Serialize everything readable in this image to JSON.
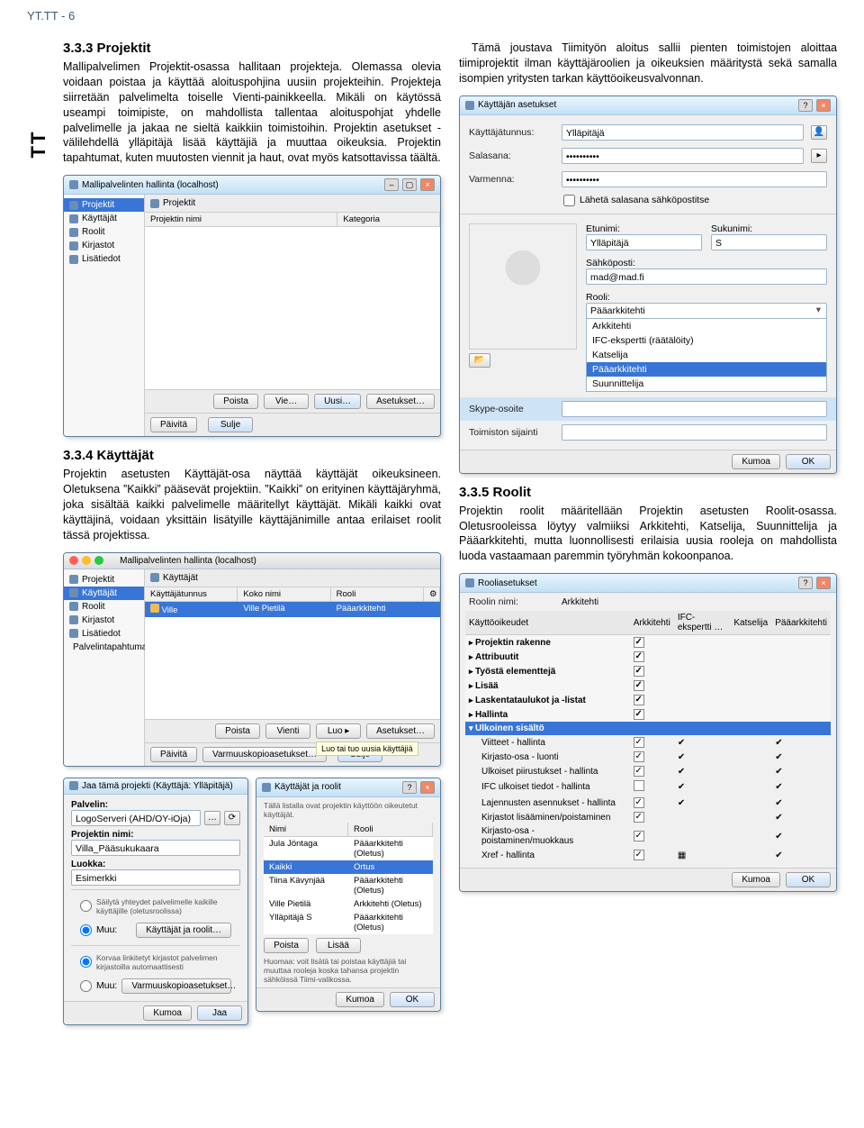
{
  "page": {
    "header": "YT.TT - 6",
    "side_label": "TT"
  },
  "col1": {
    "h1": "3.3.3   Projektit",
    "p1": "Mallipalvelimen Projektit-osassa hallitaan projekteja. Olemassa olevia voidaan poistaa ja käyttää aloituspohjina uusiin projekteihin. Projekteja siirretään palvelimelta toiselle Vienti-painikkeella. Mikäli on käytössä useampi toimipiste, on mahdollista tallentaa aloituspohjat yhdelle palvelimelle ja jakaa ne sieltä kaikkiin toimistoihin. Projektin asetukset -välilehdellä ylläpitäjä lisää käyttäjiä ja muuttaa oikeuksia. Projektin tapahtumat, kuten muutosten viennit ja haut, ovat myös katsottavissa täältä.",
    "win1": {
      "title": "Mallipalvelinten hallinta (localhost)",
      "crumb": "Projektit",
      "sidebar": [
        "Projektit",
        "Käyttäjät",
        "Roolit",
        "Kirjastot",
        "Lisätiedot"
      ],
      "cols": [
        "Projektin nimi",
        "Kategoria"
      ],
      "btn_del": "Poista",
      "btn_export": "Vie…",
      "btn_new": "Uusi…",
      "btn_settings": "Asetukset…",
      "btn_refresh": "Päivitä",
      "btn_close": "Sulje"
    },
    "h2": "3.3.4   Käyttäjät",
    "p2": "Projektin asetusten Käyttäjät-osa näyttää käyttäjät oikeuksineen. Oletuksena ”Kaikki” pääsevät projektiin. ”Kaikki” on erityinen käyttäjäryhmä, joka sisältää kaikki palvelimelle määritellyt käyttäjät. Mikäli kaikki ovat käyttäjinä, voidaan yksittäin lisätyille käyttäjänimille antaa erilaiset roolit tässä projektissa.",
    "win2": {
      "title": "Mallipalvelinten hallinta (localhost)",
      "crumb": "Käyttäjät",
      "sidebar": [
        "Projektit",
        "Käyttäjät",
        "Roolit",
        "Kirjastot",
        "Lisätiedot",
        "Palvelintapahtumat"
      ],
      "cols": [
        "Käyttäjätunnus",
        "Koko nimi",
        "Rooli"
      ],
      "row_user": "Ville",
      "row_name": "Ville Pietilä",
      "row_role": "Pääarkkitehti",
      "btn_del": "Poista",
      "btn_export": "Vienti",
      "btn_new": "Luo",
      "btn_settings": "Asetukset…",
      "hint": "Luo tai tuo uusia käyttäjiä",
      "btn_refresh": "Päivitä",
      "btn_backup": "Varmuuskopioasetukset…",
      "btn_close": "Sulje"
    },
    "win3a": {
      "title": "Jaa tämä projekti (Käyttäjä: Ylläpitäjä)",
      "server_lbl": "Palvelin:",
      "server_val": "LogoServeri (AHD/OY-iOja)",
      "proj_lbl": "Projektin nimi:",
      "proj_val": "Villa_Pääsukukaara",
      "class_lbl": "Luokka:",
      "class_val": "Esimerkki",
      "opt1": "Säilytä yhteydet palvelimelle kaikille käyttäjille (oletusroolissa)",
      "opt2": "Muu:",
      "btn_users": "Käyttäjät ja roolit…",
      "opt3_pre": "Korvaa linkitetyt kirjastot palvelimen kirjastoilla automaattisesti",
      "opt4": "Muu:",
      "btn_lib": "Varmuuskopioasetukset…",
      "btn_cancel": "Kumoa",
      "btn_ok": "Jaa"
    },
    "win3b": {
      "title": "Käyttäjät ja roolit",
      "desc": "Tällä listalla ovat projektin käyttöön oikeutetut käyttäjät.",
      "cols": [
        "Nimi",
        "Rooli"
      ],
      "rows": [
        {
          "n": "Jula Jöntaga",
          "r": "Pääarkkitehti (Oletus)"
        },
        {
          "n": "Kaikki",
          "r": "Ortus"
        },
        {
          "n": "Tiina Kävynjää",
          "r": "Pääarkkitehti (Oletus)"
        },
        {
          "n": "Ville Pietilä",
          "r": "Arkkitehti (Oletus)"
        },
        {
          "n": "Ylläpitäjä S",
          "r": "Pääarkkitehti (Oletus)"
        }
      ],
      "hint": "Huomaa: voit lisätä tai poistaa käyttäjiä tai muuttaa rooleja koska tahansa projektin sähköissä Tiimi-valikossa.",
      "btn_cancel": "Kumoa",
      "btn_ok": "Lisää",
      "btn_del": "Poista"
    }
  },
  "col2": {
    "p1": "Tämä joustava Tiimityön aloitus sallii pienten toimistojen aloittaa tiimiprojektit ilman käyttäjäroolien ja oikeuksien määritystä sekä samalla isompien yritysten tarkan käyttöoikeusvalvonnan.",
    "win1": {
      "title": "Käyttäjän asetukset",
      "user_lbl": "Käyttäjätunnus:",
      "user_val": "Ylläpitäjä",
      "pass_lbl": "Salasana:",
      "pass_val": "••••••••••",
      "conf_lbl": "Varmenna:",
      "conf_val": "••••••••••",
      "chk_email": "Lähetä salasana sähköpostitse",
      "fn_lbl": "Etunimi:",
      "fn_val": "Ylläpitäjä",
      "ln_lbl": "Sukunimi:",
      "ln_val": "S",
      "email_lbl": "Sähköposti:",
      "email_val": "mad@mad.fi",
      "role_lbl": "Rooli:",
      "role_val": "Pääarkkitehti",
      "opts": [
        "Arkkitehti",
        "IFC-ekspertti (räätälöity)",
        "Katselija",
        "Pääarkkitehti",
        "Suunnittelija"
      ],
      "skype_lbl": "Skype-osoite",
      "office_lbl": "Toimiston sijainti",
      "btn_cancel": "Kumoa",
      "btn_ok": "OK"
    },
    "h2": "3.3.5   Roolit",
    "p2": "Projektin roolit määritellään Projektin asetusten Roolit-osassa. Oletusrooleissa löytyy valmiiksi Arkkitehti, Katselija, Suunnittelija ja Pääarkkitehti, mutta luonnollisesti erilaisia uusia rooleja on mahdollista luoda vastaamaan paremmin työryhmän kokoonpanoa.",
    "win2": {
      "title": "Rooliasetukset",
      "name_lbl": "Roolin nimi:",
      "name_val": "Arkkitehti",
      "head": [
        "Käyttöoikeudet",
        "Arkkitehti",
        "IFC-ekspertti …",
        "Katselija",
        "Pääarkkitehti"
      ],
      "groups": [
        "Projektin rakenne",
        "Attribuutit",
        "Työstä elementtejä",
        "Lisää",
        "Laskentataulukot ja -listat",
        "Hallinta",
        "Ulkoinen sisältö"
      ],
      "items": [
        "Viitteet - hallinta",
        "Kirjasto-osa - luonti",
        "Ulkoiset piirustukset - hallinta",
        "IFC ulkoiset tiedot - hallinta",
        "Lajennusten asennukset - hallinta",
        "Kirjastot lisääminen/poistaminen",
        "Kirjasto-osa - poistaminen/muokkaus",
        "Xref - hallinta"
      ],
      "btn_cancel": "Kumoa",
      "btn_ok": "OK"
    }
  }
}
